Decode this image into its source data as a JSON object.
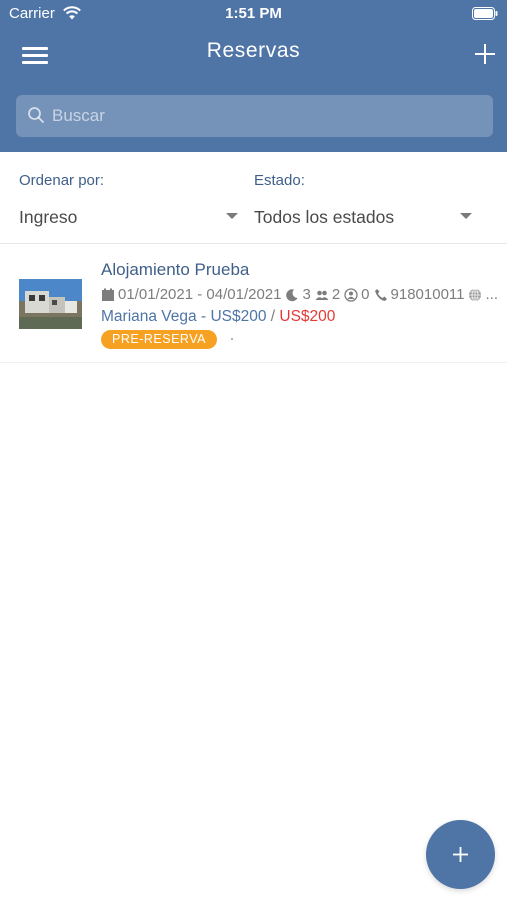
{
  "status_bar": {
    "carrier": "Carrier",
    "time": "1:51 PM"
  },
  "navbar": {
    "title": "Reservas"
  },
  "search": {
    "placeholder": "Buscar",
    "value": ""
  },
  "filters": {
    "sort": {
      "label": "Ordenar por:",
      "value": "Ingreso"
    },
    "status": {
      "label": "Estado:",
      "value": "Todos los estados"
    }
  },
  "reservations": [
    {
      "property": "Alojamiento Prueba",
      "dates": "01/01/2021 - 04/01/2021",
      "nights": "3",
      "adults": "2",
      "children": "0",
      "phone": "918010011",
      "extra": "...",
      "guest": "Mariana Vega",
      "guest_sep": " - ",
      "amount_paid": "US$200",
      "amount_sep": " / ",
      "amount_total": "US$200",
      "status": "PRE-RESERVA"
    }
  ],
  "colors": {
    "primary": "#4f74a6",
    "accent": "#f7a122",
    "danger": "#e53935"
  },
  "icons": [
    "menu-icon",
    "plus-icon",
    "search-icon",
    "calendar-icon",
    "moon-icon",
    "adults-icon",
    "child-icon",
    "phone-icon",
    "globe-icon",
    "caret-down-icon",
    "wifi-icon",
    "battery-icon"
  ]
}
